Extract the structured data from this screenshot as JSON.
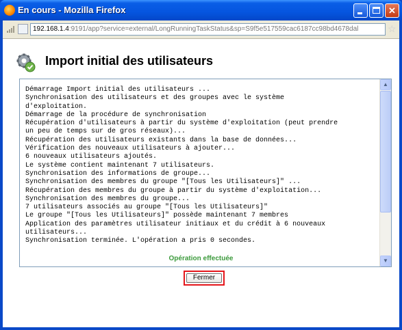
{
  "window": {
    "title": "En cours - Mozilla Firefox"
  },
  "browser": {
    "url_host": "192.168.1.4",
    "url_rest": ":9191/app?service=external/LongRunningTaskStatus&sp=S9f5e517559cac6187cc98bd4678dal"
  },
  "page": {
    "title": "Import initial des utilisateurs",
    "log_lines": [
      "Démarrage Import initial des utilisateurs ...",
      "Synchronisation des utilisateurs et des groupes avec le système",
      "d'exploitation.",
      "Démarrage de la procédure de synchronisation",
      "Récupération d'utilisateurs à partir du système d'exploitation (peut prendre",
      "un peu de temps sur de gros réseaux)...",
      "Récupération des utilisateurs existants dans la base de données...",
      "Vérification des nouveaux utilisateurs à ajouter...",
      "6 nouveaux utilisateurs ajoutés.",
      "Le système contient maintenant 7 utilisateurs.",
      "Synchronisation des informations de groupe...",
      "Synchronisation des membres du groupe \"[Tous les Utilisateurs]\" ...",
      "Récupération des membres du groupe à partir du système d'exploitation...",
      "Synchronisation des membres du groupe...",
      "7 utilisateurs associés au groupe \"[Tous les Utilisateurs]\"",
      "Le groupe \"[Tous les Utilisateurs]\" possède maintenant 7 membres",
      "Application des paramètres utilisateur initiaux et du crédit à 6 nouveaux",
      "utilisateurs...",
      "Synchronisation terminée. L'opération a pris 0 secondes."
    ],
    "status": "Opération effectuée",
    "close_label": "Fermer"
  }
}
